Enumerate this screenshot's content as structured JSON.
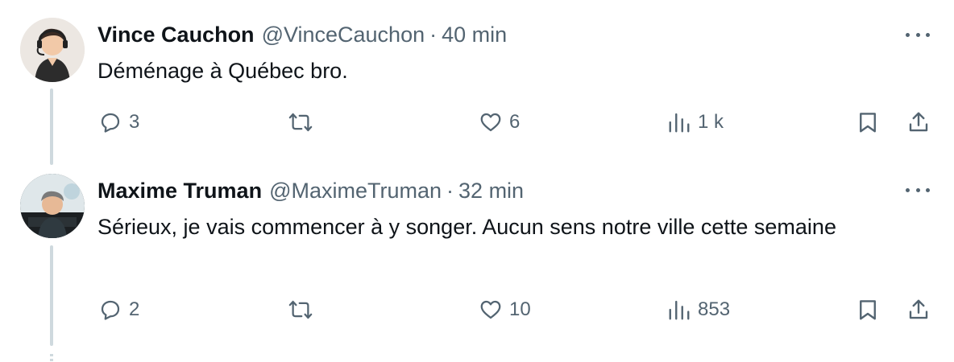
{
  "tweets": [
    {
      "name": "Vince Cauchon",
      "handle": "@VinceCauchon",
      "separator": "·",
      "time": "40 min",
      "text": "Déménage à Québec bro.",
      "replies": "3",
      "retweets": "",
      "likes": "6",
      "views": "1 k"
    },
    {
      "name": "Maxime Truman",
      "handle": "@MaximeTruman",
      "separator": "·",
      "time": "32 min",
      "text": "Sérieux, je vais commencer à y songer. Aucun sens notre ville cette semaine",
      "replies": "2",
      "retweets": "",
      "likes": "10",
      "views": "853"
    }
  ],
  "icons": {
    "reply": "reply-icon",
    "retweet": "retweet-icon",
    "like": "heart-icon",
    "views": "views-icon",
    "bookmark": "bookmark-icon",
    "share": "share-icon",
    "more": "more-icon"
  },
  "colors": {
    "text": "#0f1419",
    "secondary": "#536471",
    "thread_line": "#cfd9de"
  }
}
